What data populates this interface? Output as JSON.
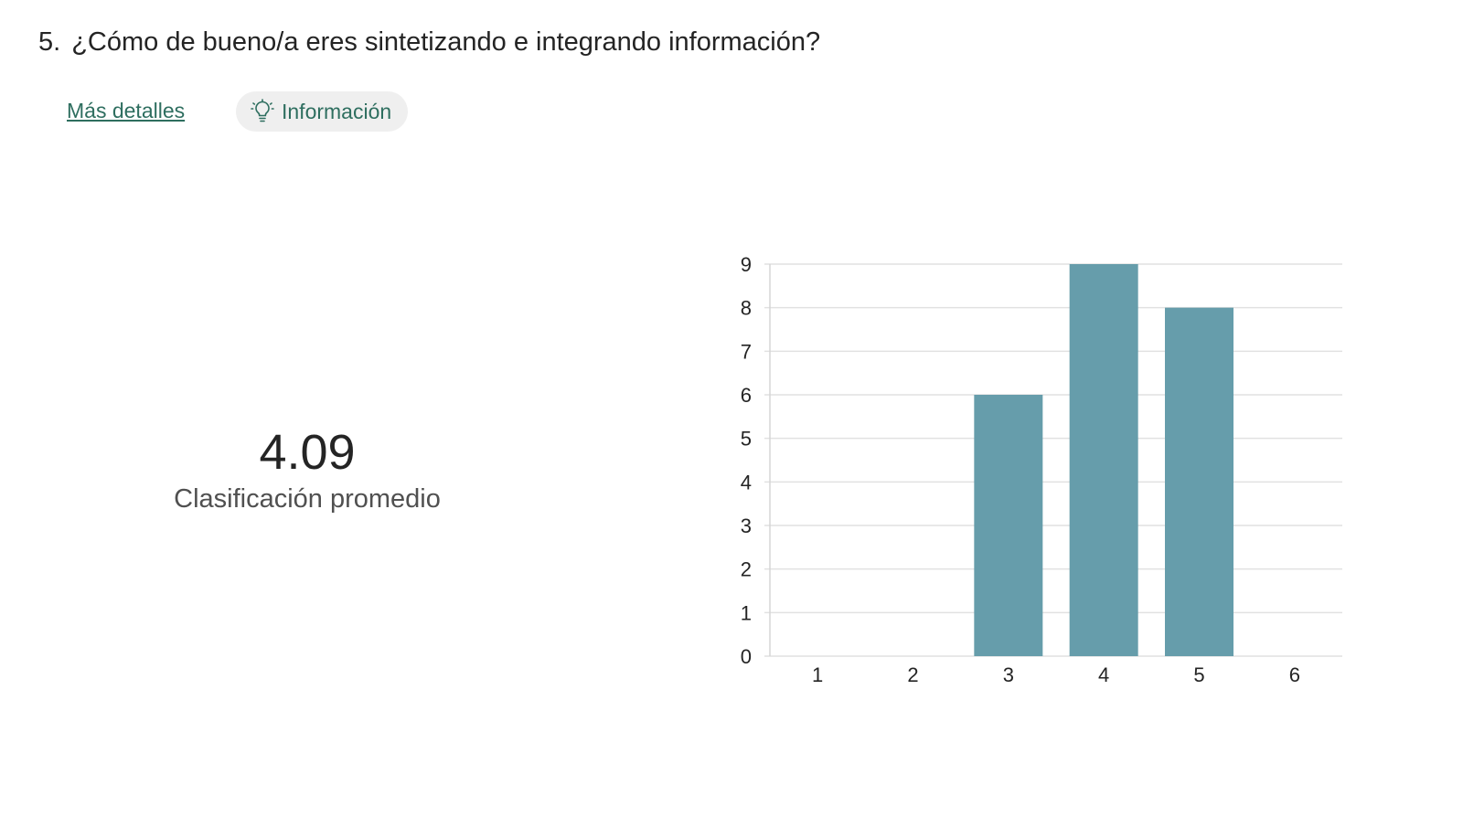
{
  "question": {
    "number": "5.",
    "text": "¿Cómo de bueno/a eres sintetizando e integrando información?"
  },
  "links": {
    "more_details": "Más detalles",
    "info": "Información",
    "info_icon": "lightbulb-icon"
  },
  "summary": {
    "average_value": "4.09",
    "average_label": "Clasificación promedio"
  },
  "colors": {
    "bar": "#669dab",
    "accent_link": "#2e6e5f",
    "grid": "#e1e1e1"
  },
  "chart_data": {
    "type": "bar",
    "categories": [
      "1",
      "2",
      "3",
      "4",
      "5",
      "6"
    ],
    "values": [
      0,
      0,
      6,
      9,
      8,
      0
    ],
    "ylim": [
      0,
      9
    ],
    "yticks": [
      0,
      1,
      2,
      3,
      4,
      5,
      6,
      7,
      8,
      9
    ],
    "grid": true,
    "title": "",
    "xlabel": "",
    "ylabel": ""
  }
}
